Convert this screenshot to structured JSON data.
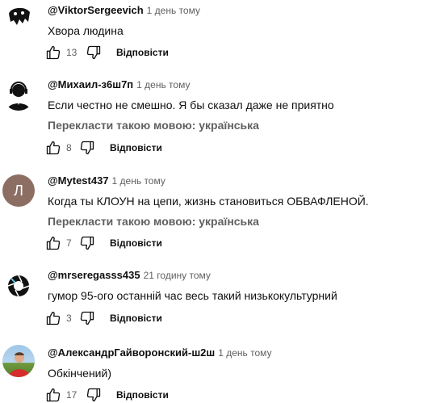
{
  "comments": [
    {
      "author": "@ViktorSergeevich",
      "time": "1 день тому",
      "text": "Хвора людина",
      "translate": "",
      "likes": "13",
      "reply_label": "Відповісти",
      "avatar_icon": "pacman-ghost-avatar"
    },
    {
      "author": "@Михаил-з6ш7п",
      "time": "1 день тому",
      "text": "Если честно не смешно. Я бы сказал даже не приятно",
      "translate": "Перекласти такою мовою: українська",
      "likes": "8",
      "reply_label": "Відповісти",
      "avatar_icon": "headset-person-avatar"
    },
    {
      "author": "@Mytest437",
      "time": "1 день тому",
      "text": "Когда ты КЛОУН на цепи, жизнь становиться ОБВАФЛЕНОЙ.",
      "translate": "Перекласти такою мовою: українська",
      "likes": "7",
      "reply_label": "Відповісти",
      "avatar_letter": "Л",
      "avatar_color": "#8d6e63"
    },
    {
      "author": "@mrseregasss435",
      "time": "21 годину тому",
      "text": "гумор 95-ого останній час весь такий низькокультурний",
      "translate": "",
      "likes": "3",
      "reply_label": "Відповісти",
      "avatar_icon": "aperture-avatar"
    },
    {
      "author": "@АлександрГайворонский-ш2ш",
      "time": "1 день тому",
      "text": "Обкінчений)",
      "translate": "",
      "likes": "17",
      "reply_label": "Відповісти",
      "avatar_icon": "photo-person-avatar"
    }
  ]
}
